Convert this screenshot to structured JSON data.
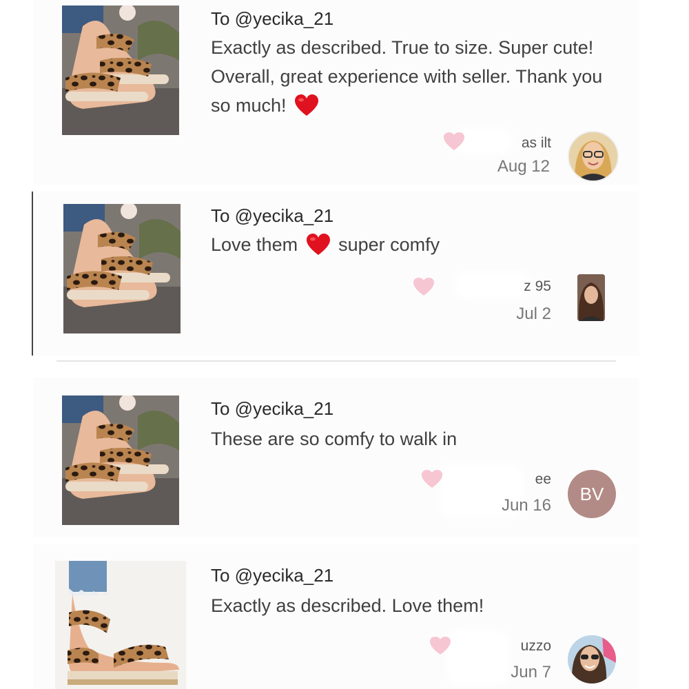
{
  "reviews": [
    {
      "recipient": "To @yecika_21",
      "comment_parts": [
        "Exactly as described. True to size. Super cute! Overall, great experience with seller. Thank you so much!",
        ""
      ],
      "username": "as          ilt",
      "date": "Aug 12",
      "avatar_text": ""
    },
    {
      "recipient": "To @yecika_21",
      "comment_parts": [
        "Love them",
        "super comfy"
      ],
      "username": "z          95",
      "date": "Jul 2",
      "avatar_text": ""
    },
    {
      "recipient": "To @yecika_21",
      "comment_parts": [
        "These are so comfy to walk in",
        ""
      ],
      "username": "        ee",
      "date": "Jun 16",
      "avatar_text": "BV"
    },
    {
      "recipient": "To @yecika_21",
      "comment_parts": [
        "Exactly as described. Love them!",
        ""
      ],
      "username": "uzzo",
      "date": "Jun 7",
      "avatar_text": ""
    }
  ],
  "icons": {
    "like": "heart-outline-pink",
    "emoji": "red-heart-emoji"
  },
  "colors": {
    "like_heart": "#f7c6d3",
    "emoji_heart": "#e0121f",
    "avatar_bv": "#b38b86"
  }
}
